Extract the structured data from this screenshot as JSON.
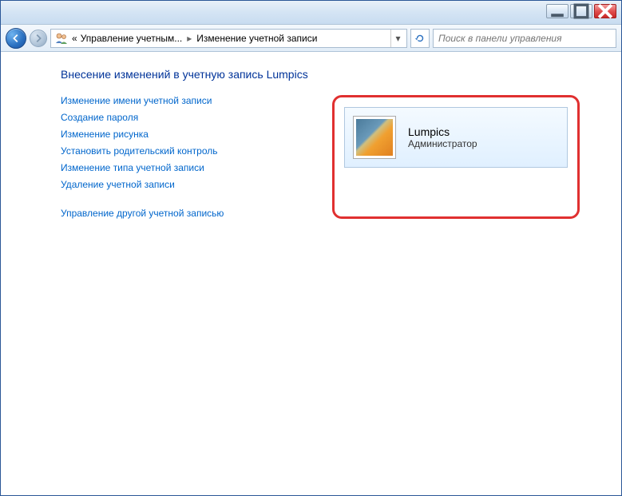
{
  "breadcrumb": {
    "prefix": "«",
    "seg1": "Управление учетным...",
    "seg2": "Изменение учетной записи"
  },
  "search": {
    "placeholder": "Поиск в панели управления"
  },
  "page": {
    "title": "Внесение изменений в учетную запись Lumpics"
  },
  "links": {
    "rename": "Изменение имени учетной записи",
    "create_password": "Создание пароля",
    "change_picture": "Изменение рисунка",
    "parental": "Установить родительский контроль",
    "change_type": "Изменение типа учетной записи",
    "delete": "Удаление учетной записи",
    "manage_other": "Управление другой учетной записью"
  },
  "account": {
    "name": "Lumpics",
    "role": "Администратор"
  }
}
